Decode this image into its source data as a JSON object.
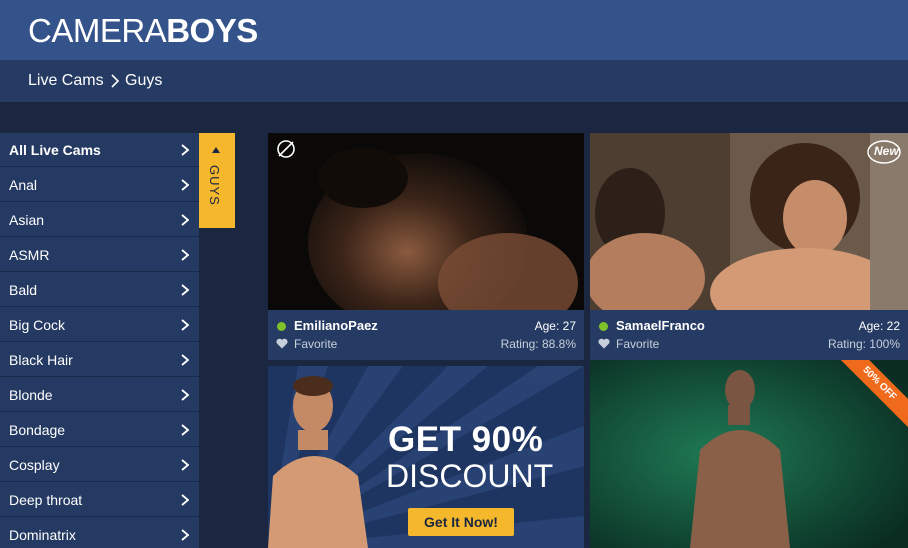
{
  "header": {
    "logo_thin": "CAMERA",
    "logo_bold": "BOYS"
  },
  "breadcrumb": {
    "items": [
      "Live Cams",
      "Guys"
    ]
  },
  "sidebar": {
    "items": [
      {
        "label": "All Live Cams",
        "active": true
      },
      {
        "label": "Anal"
      },
      {
        "label": "Asian"
      },
      {
        "label": "ASMR"
      },
      {
        "label": "Bald"
      },
      {
        "label": "Big Cock"
      },
      {
        "label": "Black Hair"
      },
      {
        "label": "Blonde"
      },
      {
        "label": "Bondage"
      },
      {
        "label": "Cosplay"
      },
      {
        "label": "Deep throat"
      },
      {
        "label": "Dominatrix"
      }
    ],
    "tab_label": "GUYS"
  },
  "cards": [
    {
      "name": "EmilianoPaez",
      "age": "Age: 27",
      "favorite": "Favorite",
      "rating": "Rating: 88.8%",
      "badge": "",
      "corner_icon": "muted-icon"
    },
    {
      "name": "SamaelFranco",
      "age": "Age: 22",
      "favorite": "Favorite",
      "rating": "Rating: 100%",
      "badge": "New"
    }
  ],
  "promo": {
    "title": "GET 90%",
    "subtitle": "DISCOUNT",
    "button": "Get It Now!"
  },
  "card4": {
    "ribbon": "50% OFF"
  },
  "colors": {
    "header": "#34538b",
    "breadcrumb_bar": "#263b63",
    "background": "#1b2640",
    "accent": "#f5b82c",
    "online": "#7ec12a",
    "ribbon": "#f06a1c"
  }
}
